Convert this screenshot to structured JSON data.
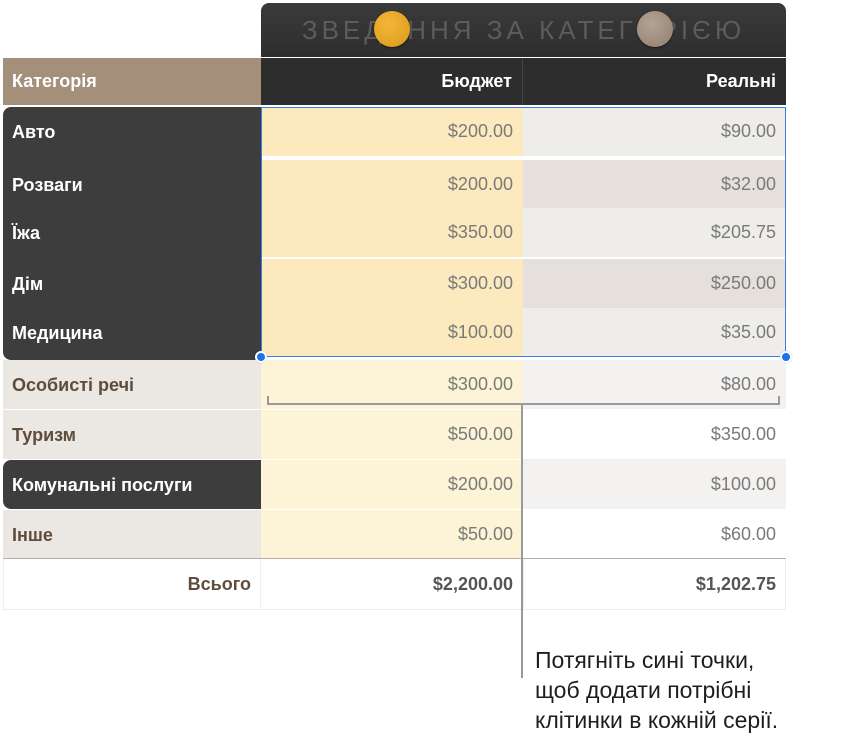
{
  "chart_header": {
    "title": "ЗВЕДЕННЯ ЗА КАТЕГОРІЄЮ"
  },
  "table": {
    "headers": {
      "category": "Категорія",
      "budget": "Бюджет",
      "actual": "Реальні"
    },
    "rows": [
      {
        "category": "Авто",
        "budget": "$200.00",
        "actual": "$90.00"
      },
      {
        "category": "Розваги",
        "budget": "$200.00",
        "actual": "$32.00"
      },
      {
        "category": "Їжа",
        "budget": "$350.00",
        "actual": "$205.75"
      },
      {
        "category": "Дім",
        "budget": "$300.00",
        "actual": "$250.00"
      },
      {
        "category": "Медицина",
        "budget": "$100.00",
        "actual": "$35.00"
      },
      {
        "category": "Особисті речі",
        "budget": "$300.00",
        "actual": "$80.00"
      },
      {
        "category": "Туризм",
        "budget": "$500.00",
        "actual": "$350.00"
      },
      {
        "category": "Комунальні послуги",
        "budget": "$200.00",
        "actual": "$100.00"
      },
      {
        "category": "Інше",
        "budget": "$50.00",
        "actual": "$60.00"
      }
    ],
    "total": {
      "label": "Всього",
      "budget": "$2,200.00",
      "actual": "$1,202.75"
    }
  },
  "callout": {
    "line1": "Потягніть сині точки,",
    "line2": "щоб додати потрібні",
    "line3": "клітинки в кожній серії."
  },
  "colors": {
    "header_dark": "#2d2d2d",
    "category_header": "#a38f7a",
    "budget_series": "#f2ad2a",
    "actual_series": "#a08f80",
    "selection_blue": "#1a73e8"
  }
}
